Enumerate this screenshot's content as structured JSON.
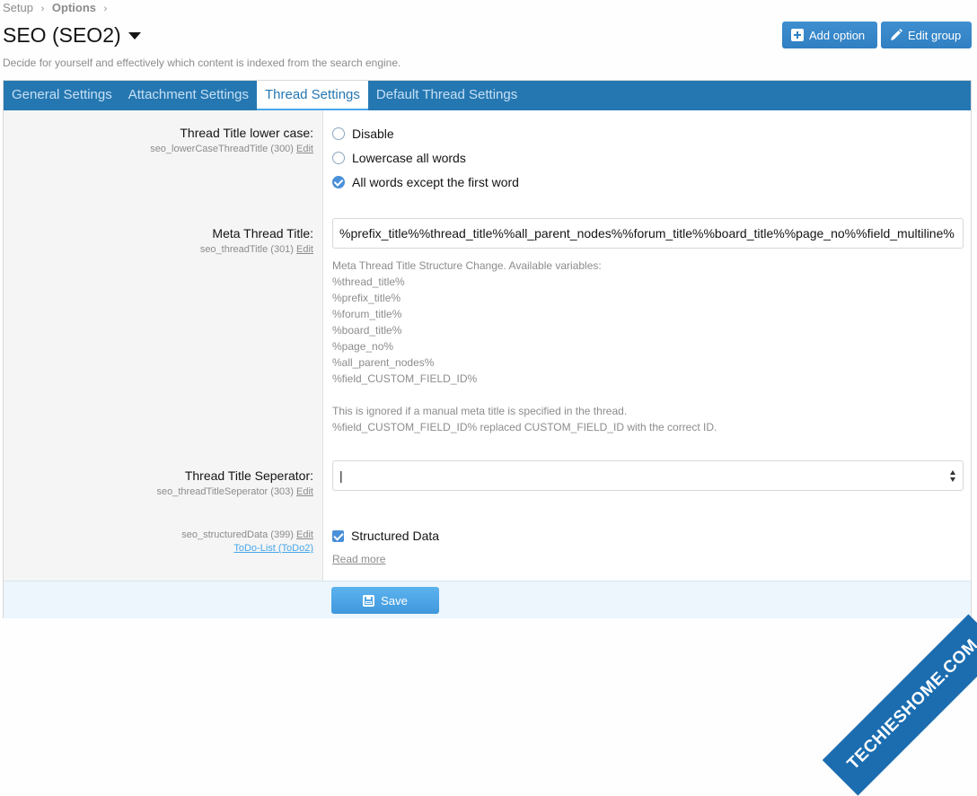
{
  "breadcrumb": {
    "setup": "Setup",
    "options": "Options"
  },
  "page": {
    "title": "SEO (SEO2)",
    "description": "Decide for yourself and effectively which content is indexed from the search engine."
  },
  "header_buttons": {
    "add_option": "Add option",
    "edit_group": "Edit group"
  },
  "tabs": [
    {
      "label": "General Settings"
    },
    {
      "label": "Attachment Settings"
    },
    {
      "label": "Thread Settings",
      "active": true
    },
    {
      "label": "Default Thread Settings"
    }
  ],
  "rows": {
    "lowercase": {
      "label": "Thread Title lower case:",
      "hint": "seo_lowerCaseThreadTitle (300)",
      "edit": "Edit",
      "options": [
        "Disable",
        "Lowercase all words",
        "All words except the first word"
      ],
      "selected": 2
    },
    "meta": {
      "label": "Meta Thread Title:",
      "hint": "seo_threadTitle (301)",
      "edit": "Edit",
      "value": "%prefix_title%%thread_title%%all_parent_nodes%%forum_title%%board_title%%page_no%%field_multiline%",
      "explain": [
        "Meta Thread Title Structure Change. Available variables:",
        "%thread_title%",
        "%prefix_title%",
        "%forum_title%",
        "%board_title%",
        "%page_no%",
        "%all_parent_nodes%",
        "%field_CUSTOM_FIELD_ID%"
      ],
      "explain2": [
        "This is ignored if a manual meta title is specified in the thread.",
        "%field_CUSTOM_FIELD_ID% replaced CUSTOM_FIELD_ID with the correct ID."
      ]
    },
    "separator": {
      "label": "Thread Title Seperator:",
      "hint": "seo_threadTitleSeperator (303)",
      "edit": "Edit",
      "value": "|"
    },
    "structured": {
      "hint": "seo_structuredData (399)",
      "edit": "Edit",
      "todo": "ToDo-List (ToDo2)",
      "checkbox": "Structured Data",
      "read_more": "Read more"
    }
  },
  "footer": {
    "save": "Save"
  },
  "watermark": "TECHIESHOME.COM"
}
